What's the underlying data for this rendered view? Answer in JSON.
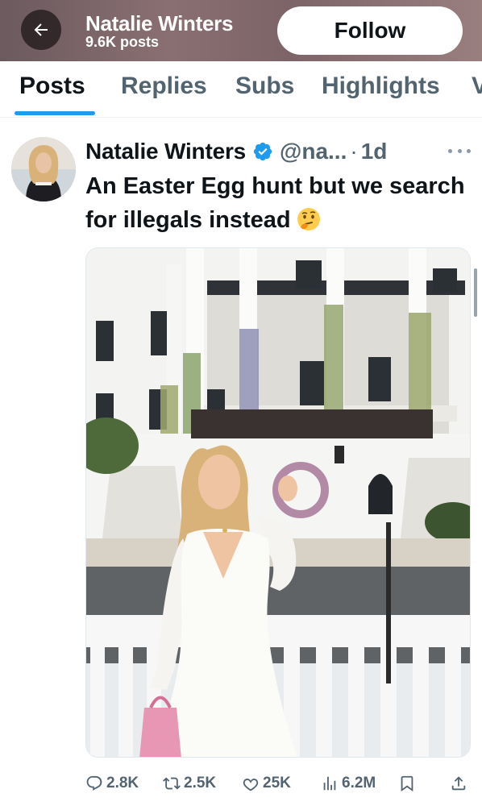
{
  "header": {
    "name": "Natalie Winters",
    "posts_count": "9.6K posts",
    "follow_label": "Follow",
    "back_icon": "arrow-left-icon",
    "banner_color": "#7d6468"
  },
  "tabs": [
    {
      "label": "Posts",
      "active": true
    },
    {
      "label": "Replies",
      "active": false
    },
    {
      "label": "Subs",
      "active": false
    },
    {
      "label": "Highlights",
      "active": false
    },
    {
      "label": "V",
      "active": false
    }
  ],
  "post": {
    "author": "Natalie Winters",
    "verified": true,
    "handle": "@na...",
    "separator": "·",
    "time": "1d",
    "text": "An Easter Egg hunt but we search for illegals instead",
    "emoji": "thinking-face",
    "actions": {
      "replies": "2.8K",
      "reposts": "2.5K",
      "likes": "25K",
      "views": "6.2M"
    }
  },
  "colors": {
    "accent": "#1d9bf0",
    "text_primary": "#0f1419",
    "text_secondary": "#536471"
  }
}
